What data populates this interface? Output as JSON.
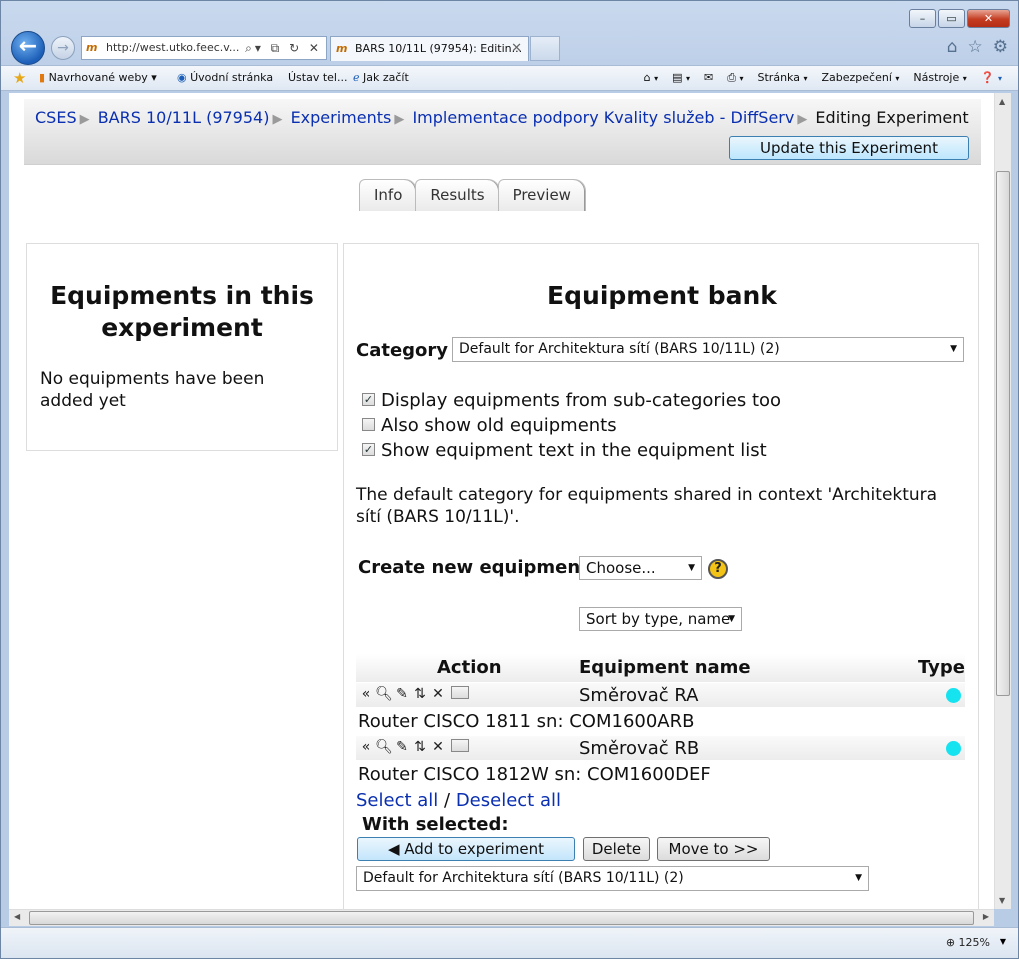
{
  "browser": {
    "address_url": "http://west.utko.feec.v...",
    "tab_active_title": "BARS 10/11L (97954): Editin...",
    "favorites": [
      {
        "label": "Navrhované weby ▾"
      },
      {
        "label": "Úvodní stránka"
      },
      {
        "label": "Ústav tel..."
      },
      {
        "label": "Jak začít"
      }
    ],
    "commands": [
      "Stránka",
      "Zabezpečení",
      "Nástroje"
    ],
    "zoom": "125%"
  },
  "breadcrumb": {
    "items": [
      "CSES",
      "BARS 10/11L (97954)",
      "Experiments",
      "Implementace podpory Kvality služeb - DiffServ"
    ],
    "current": "Editing Experiment"
  },
  "update_button": "Update this Experiment",
  "tabs": [
    "Info",
    "Results",
    "Preview"
  ],
  "left_panel": {
    "title": "Equipments in this experiment",
    "empty_text": "No equipments have been added yet"
  },
  "bank": {
    "title": "Equipment bank",
    "category_label": "Category",
    "category_value": "Default for Architektura sítí (BARS 10/11L) (2)",
    "options": [
      {
        "label": "Display equipments from sub-categories too",
        "checked": true
      },
      {
        "label": "Also show old equipments",
        "checked": false
      },
      {
        "label": "Show equipment text in the equipment list",
        "checked": true
      }
    ],
    "description": "The default category for equipments shared in context 'Architektura sítí (BARS 10/11L)'.",
    "create_label": "Create new equipment",
    "create_select": "Choose...",
    "help_glyph": "?",
    "sort_select": "Sort by type, name",
    "columns": [
      "Action",
      "Equipment name",
      "Type"
    ],
    "rows": [
      {
        "name": "Směrovač RA",
        "text": "Router CISCO 1811 sn: COM1600ARB",
        "type_color": "#15e3f0"
      },
      {
        "name": "Směrovač RB",
        "text": "Router CISCO 1812W sn: COM1600DEF",
        "type_color": "#15e3f0"
      }
    ],
    "select_all": "Select all",
    "separator": " / ",
    "deselect_all": "Deselect all",
    "with_selected": "With selected:",
    "add_button": "◀ Add to experiment",
    "delete_button": "Delete",
    "move_button": "Move to >>",
    "move_target": "Default for Architektura sítí (BARS 10/11L) (2)"
  }
}
